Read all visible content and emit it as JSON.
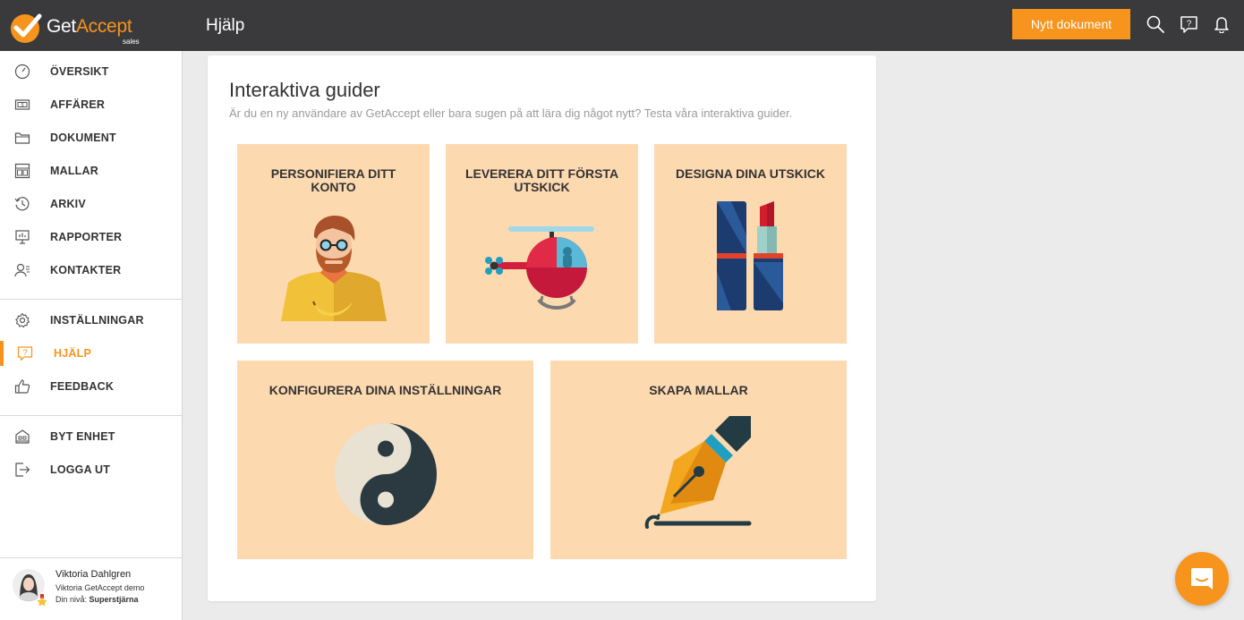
{
  "header": {
    "brand_get": "Get",
    "brand_accept": "Accept",
    "brand_sub": "sales",
    "page_title": "Hjälp",
    "new_document_label": "Nytt dokument",
    "icons": [
      "search-icon",
      "help-chat-icon",
      "bell-icon"
    ],
    "accent_color": "#f7941d",
    "bar_color": "#3a3a3d"
  },
  "sidebar": {
    "items": [
      {
        "label": "ÖVERSIKT",
        "icon": "dashboard-icon"
      },
      {
        "label": "AFFÄRER",
        "icon": "deals-icon"
      },
      {
        "label": "DOKUMENT",
        "icon": "documents-icon"
      },
      {
        "label": "MALLAR",
        "icon": "templates-icon"
      },
      {
        "label": "ARKIV",
        "icon": "archive-icon"
      },
      {
        "label": "RAPPORTER",
        "icon": "reports-icon"
      },
      {
        "label": "KONTAKTER",
        "icon": "contacts-icon"
      },
      {
        "label": "INSTÄLLNINGAR",
        "icon": "gear-icon"
      },
      {
        "label": "HJÄLP",
        "icon": "help-icon",
        "active": true
      },
      {
        "label": "FEEDBACK",
        "icon": "thumbs-up-icon"
      },
      {
        "label": "BYT ENHET",
        "icon": "switch-entity-icon"
      },
      {
        "label": "LOGGA UT",
        "icon": "logout-icon"
      }
    ],
    "user": {
      "name": "Viktoria Dahlgren",
      "company": "Viktoria GetAccept demo",
      "level_prefix": "Din nivå:",
      "level": "Superstjärna"
    }
  },
  "main": {
    "title": "Interaktiva guider",
    "subtitle": "Är du en ny användare av GetAccept eller bara sugen på att lära dig något nytt? Testa våra interaktiva guider.",
    "tile_color": "#fdd9b0",
    "guides": [
      {
        "title": "PERSONIFIERA DITT KONTO",
        "icon": "person-icon"
      },
      {
        "title": "LEVERERA DITT FÖRSTA UTSKICK",
        "icon": "helicopter-icon"
      },
      {
        "title": "DESIGNA DINA UTSKICK",
        "icon": "lipstick-icon"
      },
      {
        "title": "KONFIGURERA DINA INSTÄLLNINGAR",
        "icon": "yin-yang-icon"
      },
      {
        "title": "SKAPA MALLAR",
        "icon": "fountain-pen-icon"
      }
    ]
  }
}
